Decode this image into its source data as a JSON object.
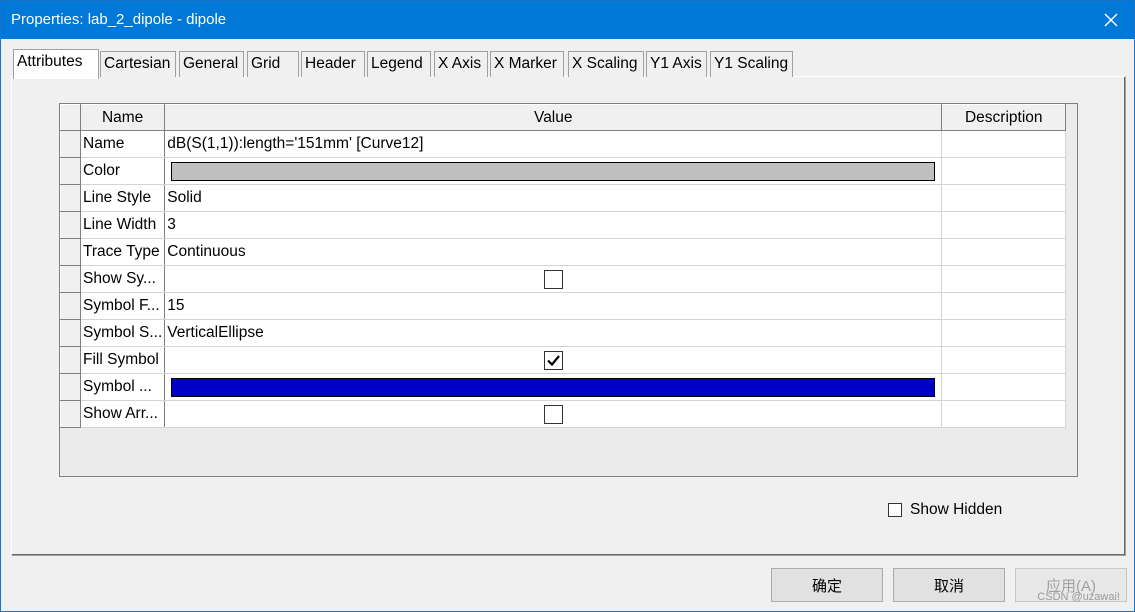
{
  "window": {
    "title": "Properties: lab_2_dipole - dipole"
  },
  "tabs": [
    {
      "label": "Attributes",
      "active": true
    },
    {
      "label": "Cartesian"
    },
    {
      "label": "General"
    },
    {
      "label": "Grid"
    },
    {
      "label": "Header"
    },
    {
      "label": "Legend"
    },
    {
      "label": "X Axis"
    },
    {
      "label": "X Marker"
    },
    {
      "label": "X Scaling"
    },
    {
      "label": "Y1 Axis"
    },
    {
      "label": "Y1 Scaling"
    }
  ],
  "grid": {
    "columns": {
      "name": "Name",
      "value": "Value",
      "description": "Description"
    },
    "rows": [
      {
        "name": "Name",
        "value": "dB(S(1,1)):length='151mm' [Curve12]",
        "type": "text"
      },
      {
        "name": "Color",
        "value": "",
        "type": "color",
        "color": "#c0c0c0"
      },
      {
        "name": "Line Style",
        "value": "Solid",
        "type": "text"
      },
      {
        "name": "Line Width",
        "value": "3",
        "type": "text"
      },
      {
        "name": "Trace Type",
        "value": "Continuous",
        "type": "text"
      },
      {
        "name": "Show Sy...",
        "value": "",
        "type": "checkbox",
        "checked": false
      },
      {
        "name": "Symbol F...",
        "value": "15",
        "type": "text"
      },
      {
        "name": "Symbol S...",
        "value": "VerticalEllipse",
        "type": "text"
      },
      {
        "name": "Fill Symbol",
        "value": "",
        "type": "checkbox",
        "checked": true
      },
      {
        "name": "Symbol ...",
        "value": "",
        "type": "color",
        "color": "#0000c8"
      },
      {
        "name": "Show Arr...",
        "value": "",
        "type": "checkbox",
        "checked": false
      }
    ]
  },
  "show_hidden": {
    "label": "Show Hidden",
    "checked": false
  },
  "buttons": {
    "ok": "确定",
    "cancel": "取消",
    "apply": "应用(A)"
  },
  "watermark": "CSDN @uzawai!"
}
